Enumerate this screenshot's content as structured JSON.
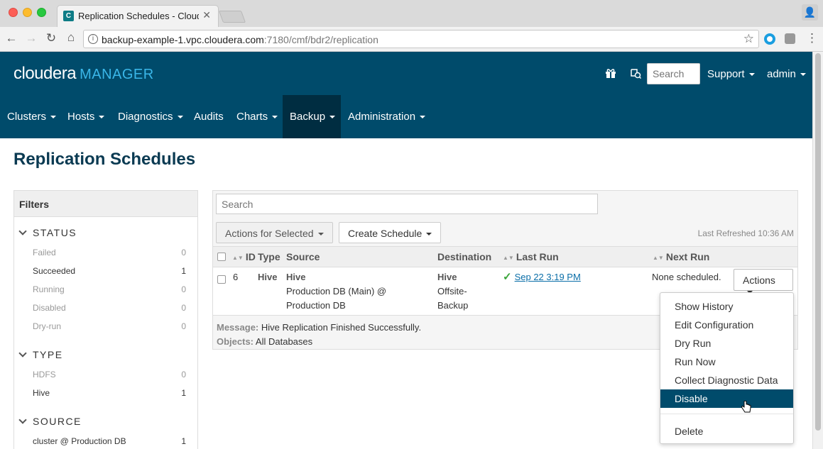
{
  "browser": {
    "tab_title": "Replication Schedules - Cloudera Manager",
    "url_host": "backup-example-1.vpc.cloudera.com",
    "url_path": ":7180/cmf/bdr2/replication",
    "icons": [
      "back-icon",
      "forward-icon",
      "reload-icon",
      "home-icon",
      "info-icon",
      "star-icon",
      "extension-icon",
      "menu-icon",
      "profile-icon"
    ]
  },
  "header": {
    "logo_text": "cloudera",
    "logo_sub": "MANAGER",
    "search_placeholder": "Search",
    "support_label": "Support",
    "user_label": "admin",
    "brand_color": "#004b6b"
  },
  "menu": {
    "items": [
      {
        "label": "Clusters"
      },
      {
        "label": "Hosts"
      },
      {
        "label": "Diagnostics"
      },
      {
        "label": "Audits"
      },
      {
        "label": "Charts"
      },
      {
        "label": "Backup"
      },
      {
        "label": "Administration"
      }
    ],
    "active": "Backup"
  },
  "page": {
    "title": "Replication Schedules"
  },
  "filters": {
    "heading": "Filters",
    "status": {
      "title": "STATUS",
      "rows": [
        {
          "label": "Failed",
          "count": "0"
        },
        {
          "label": "Succeeded",
          "count": "1"
        },
        {
          "label": "Running",
          "count": "0"
        },
        {
          "label": "Disabled",
          "count": "0"
        },
        {
          "label": "Dry-run",
          "count": "0"
        }
      ]
    },
    "type": {
      "title": "TYPE",
      "rows": [
        {
          "label": "HDFS",
          "count": "0"
        },
        {
          "label": "Hive",
          "count": "1"
        }
      ]
    },
    "source": {
      "title": "SOURCE",
      "rows": [
        {
          "label": "cluster @ Production DB",
          "count": "1"
        }
      ]
    }
  },
  "main": {
    "search_placeholder": "Search",
    "actions_selected_label": "Actions for Selected",
    "create_schedule_label": "Create Schedule",
    "last_refreshed": "Last Refreshed 10:36 AM",
    "columns": {
      "id": "ID",
      "type": "Type",
      "source": "Source",
      "destination": "Destination",
      "last_run": "Last Run",
      "next_run": "Next Run"
    },
    "row": {
      "id": "6",
      "type": "Hive",
      "source_title": "Hive",
      "source_line1": "Production DB (Main) @",
      "source_line2": "Production DB",
      "dest_title": "Hive",
      "dest_line1": "Offsite-",
      "dest_line2": "Backup",
      "last_run": "Sep 22 3:19 PM",
      "next_run": "None scheduled.",
      "actions_label": "Actions"
    },
    "message_label": "Message:",
    "message_text": "Hive Replication Finished Successfully.",
    "objects_label": "Objects:",
    "objects_text": "All Databases"
  },
  "actions_menu": {
    "items": [
      {
        "label": "Show History"
      },
      {
        "label": "Edit Configuration"
      },
      {
        "label": "Dry Run"
      },
      {
        "label": "Run Now"
      },
      {
        "label": "Collect Diagnostic Data"
      },
      {
        "label": "Disable"
      },
      {
        "label": "Delete"
      }
    ],
    "highlighted": "Disable"
  }
}
